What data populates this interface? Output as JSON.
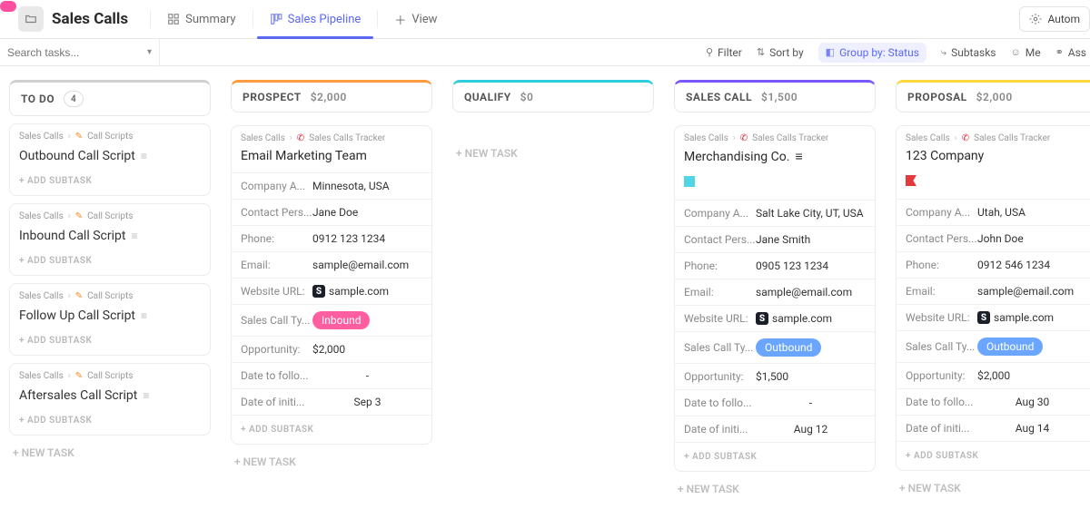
{
  "header": {
    "title": "Sales Calls",
    "tabs": [
      {
        "label": "Summary"
      },
      {
        "label": "Sales Pipeline",
        "active": true
      },
      {
        "label": "View"
      }
    ],
    "automations": "Autom"
  },
  "toolbar": {
    "search_placeholder": "Search tasks...",
    "filter": "Filter",
    "sortby": "Sort by",
    "groupby": "Group by: Status",
    "subtasks": "Subtasks",
    "me": "Me",
    "assignee": "Ass"
  },
  "labels": {
    "add_subtask": "+ ADD SUBTASK",
    "new_task": "+  NEW TASK",
    "fields": {
      "company_address": "Company A...",
      "contact_person": "Contact Pers...",
      "phone": "Phone:",
      "email": "Email:",
      "website": "Website URL:",
      "call_type": "Sales Call Ty...",
      "opportunity": "Opportunity:",
      "follow": "Date to follo...",
      "initial": "Date of initi..."
    }
  },
  "crumbs": {
    "root": "Sales Calls",
    "scripts": "Call Scripts",
    "tracker": "Sales Calls Tracker"
  },
  "columns": [
    {
      "key": "todo",
      "name": "TO DO",
      "sub_count": "4"
    },
    {
      "key": "prospect",
      "name": "PROSPECT",
      "sub_money": "$2,000"
    },
    {
      "key": "qualify",
      "name": "QUALIFY",
      "sub_money": "$0"
    },
    {
      "key": "sales",
      "name": "SALES CALL",
      "sub_money": "$1,500"
    },
    {
      "key": "proposal",
      "name": "PROPOSAL",
      "sub_money": "$2,000"
    }
  ],
  "todo_cards": [
    {
      "title": "Outbound Call Script"
    },
    {
      "title": "Inbound Call Script"
    },
    {
      "title": "Follow Up Call Script"
    },
    {
      "title": "Aftersales Call Script"
    }
  ],
  "prospect_card": {
    "title": "Email Marketing Team",
    "company_address": "Minnesota, USA",
    "contact_person": "Jane Doe",
    "phone": "0912 123 1234",
    "email": "sample@email.com",
    "website": "sample.com",
    "call_type": "Inbound",
    "opportunity": "$2,000",
    "follow": "-",
    "initial": "Sep 3"
  },
  "sales_card": {
    "title": "Merchandising Co.",
    "company_address": "Salt Lake City, UT, USA",
    "contact_person": "Jane Smith",
    "phone": "0905 123 1234",
    "email": "sample@email.com",
    "website": "sample.com",
    "call_type": "Outbound",
    "opportunity": "$1,500",
    "follow": "-",
    "initial": "Aug 12"
  },
  "proposal_card": {
    "title": "123 Company",
    "company_address": "Utah, USA",
    "contact_person": "John Doe",
    "phone": "0912 546 1234",
    "email": "sample@email.com",
    "website": "sample.com",
    "call_type": "Outbound",
    "opportunity": "$2,000",
    "follow": "Aug 30",
    "initial": "Aug 14"
  }
}
